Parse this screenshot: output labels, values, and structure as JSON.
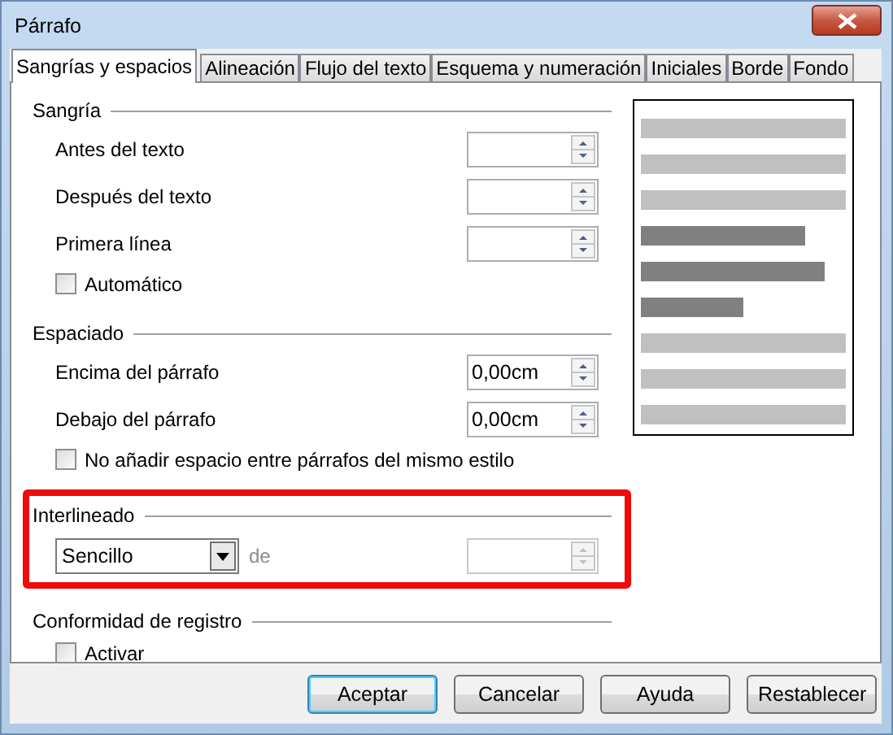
{
  "window": {
    "title": "Párrafo"
  },
  "tabs": [
    {
      "label": "Sangrías y espacios",
      "selected": true
    },
    {
      "label": "Alineación",
      "selected": false
    },
    {
      "label": "Flujo del texto",
      "selected": false
    },
    {
      "label": "Esquema y numeración",
      "selected": false
    },
    {
      "label": "Iniciales",
      "selected": false
    },
    {
      "label": "Borde",
      "selected": false
    },
    {
      "label": "Fondo",
      "selected": false
    }
  ],
  "sections": [
    {
      "title": "Sangría",
      "highlighted": false,
      "rows": [
        {
          "kind": "spin",
          "label": "Antes del texto",
          "value": "",
          "disabled": false
        },
        {
          "kind": "spin",
          "label": "Después del texto",
          "value": "",
          "disabled": false
        },
        {
          "kind": "spin",
          "label": "Primera línea",
          "value": "",
          "disabled": false
        },
        {
          "kind": "checkbox",
          "label": "Automático",
          "checked": false
        }
      ]
    },
    {
      "title": "Espaciado",
      "highlighted": false,
      "rows": [
        {
          "kind": "spin",
          "label": "Encima del párrafo",
          "value": "0,00cm",
          "disabled": false
        },
        {
          "kind": "spin",
          "label": "Debajo del párrafo",
          "value": "0,00cm",
          "disabled": false
        },
        {
          "kind": "checkbox",
          "label": "No añadir espacio entre párrafos del mismo estilo",
          "checked": false
        }
      ]
    },
    {
      "title": "Interlineado",
      "highlighted": true,
      "rows": [
        {
          "kind": "dropdown",
          "value": "Sencillo",
          "label": "de",
          "disabled": true
        }
      ]
    },
    {
      "title": "Conformidad de registro",
      "highlighted": false,
      "rows": [
        {
          "kind": "checkbox",
          "label": "Activar",
          "checked": false
        }
      ]
    }
  ],
  "buttons": [
    {
      "label": "Aceptar",
      "default": true
    },
    {
      "label": "Cancelar",
      "default": false
    },
    {
      "label": "Ayuda",
      "default": false
    },
    {
      "label": "Restablecer",
      "default": false
    }
  ]
}
